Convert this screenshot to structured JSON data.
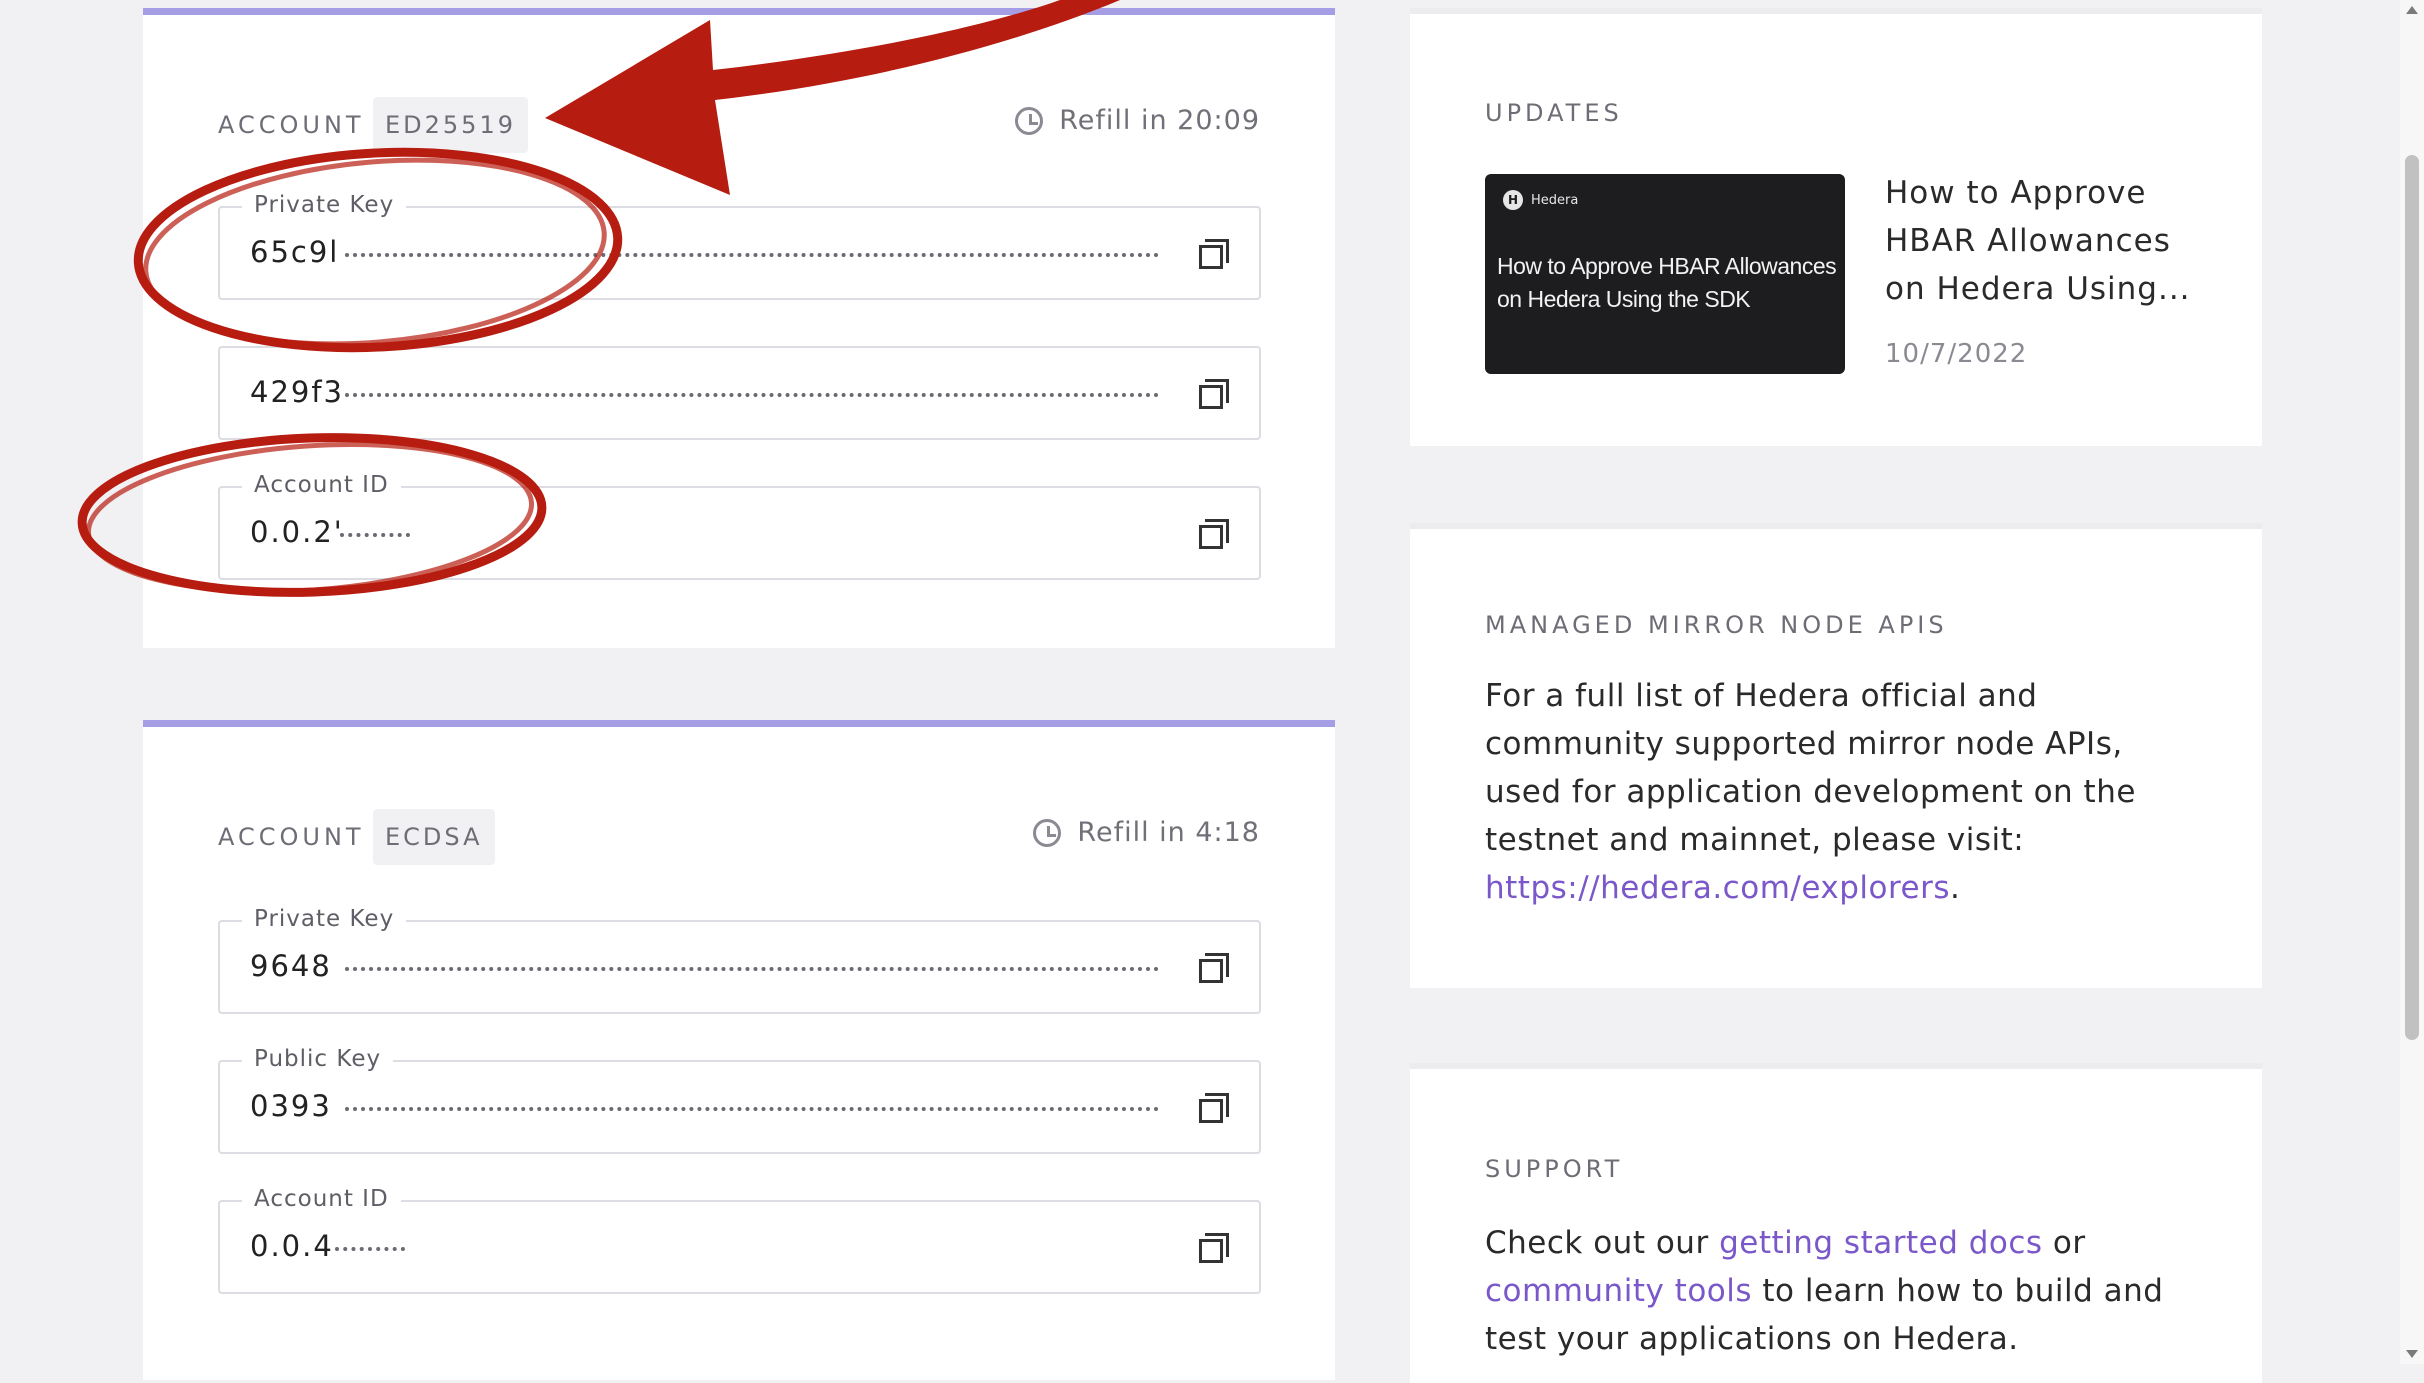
{
  "accounts": [
    {
      "label": "ACCOUNT",
      "type": "ED25519",
      "refill": "Refill in 20:09",
      "fields": [
        {
          "label": "Private Key",
          "value": "65c9l"
        },
        {
          "label": "",
          "value": "429f3"
        },
        {
          "label": "Account ID",
          "value": "0.0.2'"
        }
      ]
    },
    {
      "label": "ACCOUNT",
      "type": "ECDSA",
      "refill": "Refill in 4:18",
      "fields": [
        {
          "label": "Private Key",
          "value": "9648"
        },
        {
          "label": "Public Key",
          "value": "0393"
        },
        {
          "label": "Account ID",
          "value": "0.0.4"
        }
      ]
    }
  ],
  "updates": {
    "title": "UPDATES",
    "thumb_logo": "Hedera",
    "thumb_logo_mark": "H",
    "thumb_title": "How to Approve HBAR Allowances on Hedera Using the SDK",
    "item_title": "How to Approve HBAR Allowances on Hedera Using...",
    "item_date": "10/7/2022"
  },
  "mirror": {
    "title": "MANAGED MIRROR NODE APIS",
    "text": "For a full list of Hedera official and community supported mirror node APIs, used for application development on the testnet and mainnet, please visit: ",
    "link": "https://hedera.com/explorers",
    "suffix": "."
  },
  "support": {
    "title": "SUPPORT",
    "text1": "Check out our ",
    "link1": "getting started docs",
    "text2": " or ",
    "link2": "community tools",
    "text3": " to learn how to build and test your applications on Hedera."
  },
  "colors": {
    "accent_bar": "#a69ee4",
    "link": "#7a58c9",
    "annotation_red": "#b71c10"
  }
}
